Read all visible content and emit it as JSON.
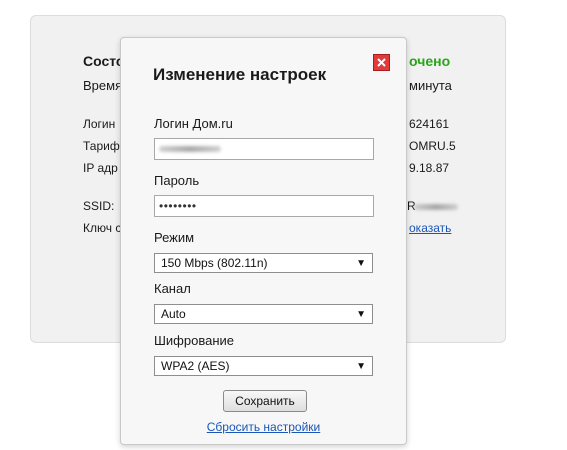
{
  "background": {
    "status_label": "Состо",
    "status_value": "очено",
    "time_label": "Время",
    "time_value": "минута",
    "login_label": "Логин",
    "login_value": "624161",
    "tariff_label": "Тариф",
    "tariff_value": "OMRU.5",
    "ip_label": "IP адр",
    "ip_value": "9.18.87",
    "ssid_label": "SSID:",
    "ssid_value": "R",
    "key_label": "Ключ с",
    "show_link": "оказать"
  },
  "dialog": {
    "title": "Изменение настроек",
    "close_icon": "close-icon",
    "login_label": "Логин Дом.ru",
    "login_value": "",
    "password_label": "Пароль",
    "password_value": "••••••••",
    "mode_label": "Режим",
    "mode_value": "150 Mbps (802.11n)",
    "channel_label": "Канал",
    "channel_value": "Auto",
    "encryption_label": "Шифрование",
    "encryption_value": "WPA2 (AES)",
    "save_label": "Сохранить",
    "reset_label": "Сбросить настройки"
  },
  "colors": {
    "accent_green": "#2aa51a",
    "link_blue": "#1a56b8",
    "close_red": "#e23a3a"
  }
}
